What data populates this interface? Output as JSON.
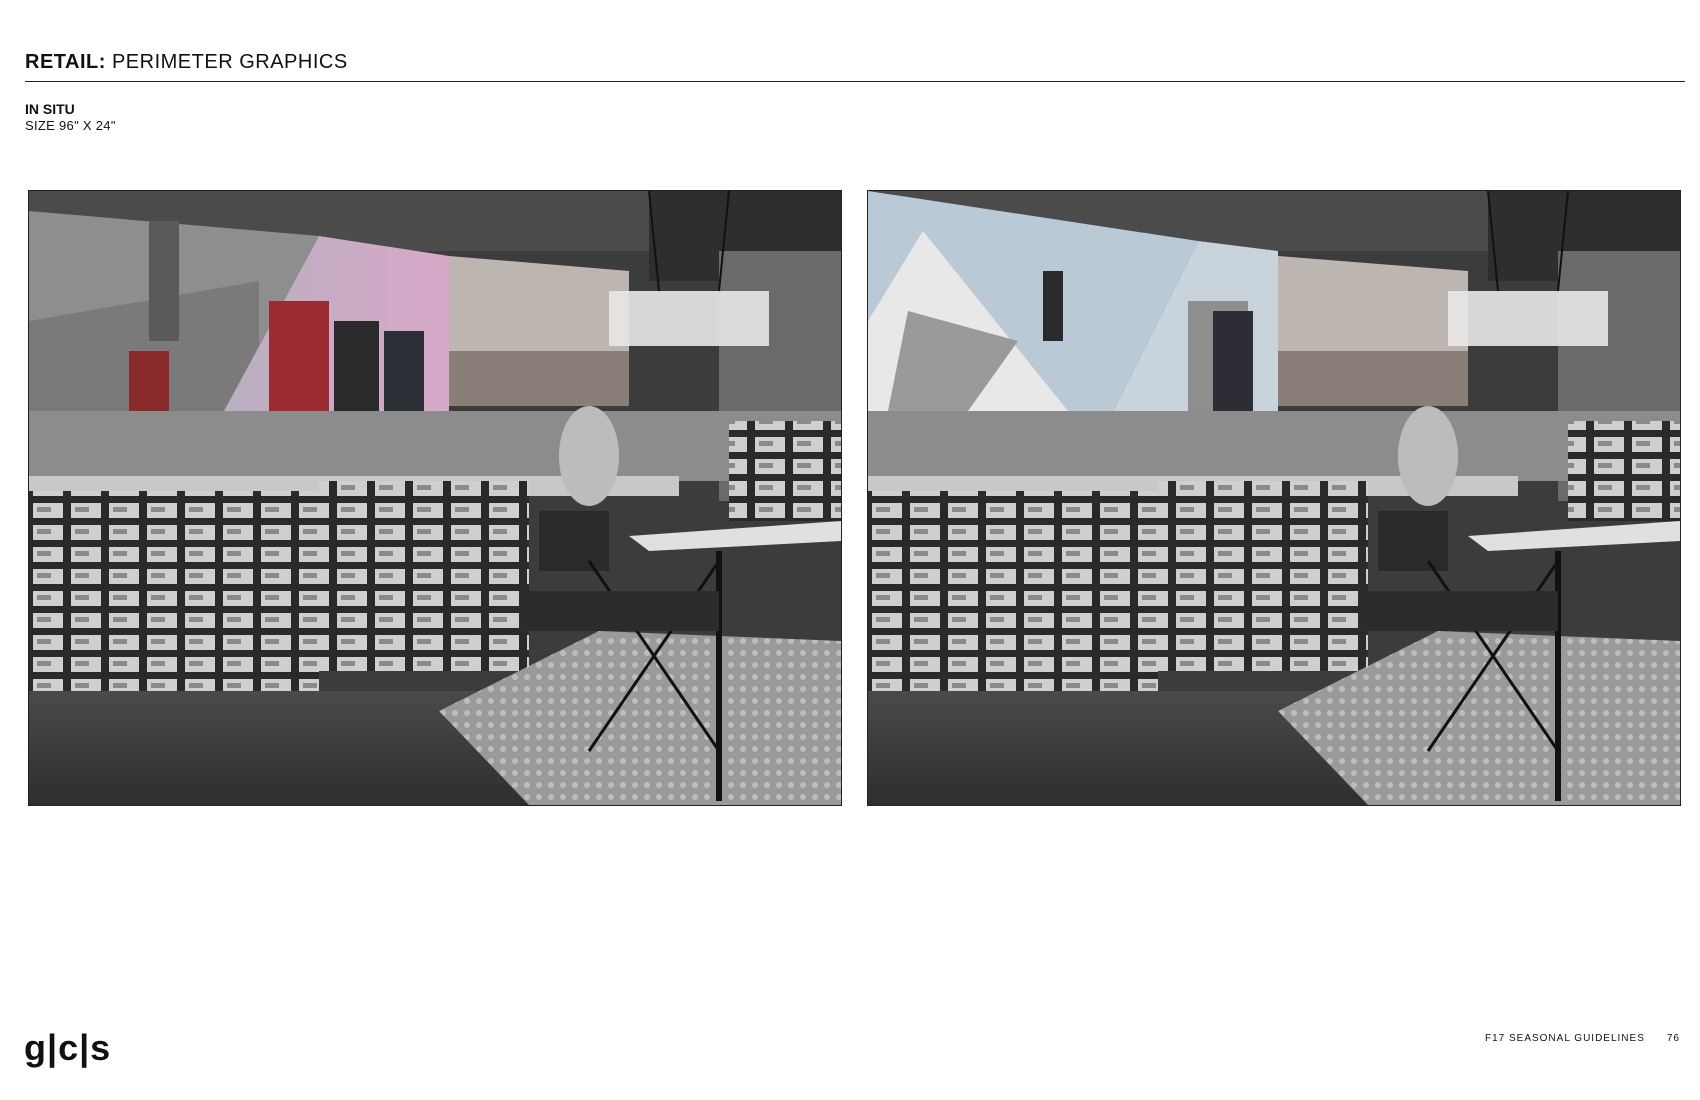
{
  "header": {
    "title_bold": "RETAIL:",
    "title_light": " PERIMETER GRAPHICS"
  },
  "subheader": {
    "label": "IN SITU",
    "size": "SIZE 96\" X 24\""
  },
  "images": [
    {
      "name": "in-situ-rendering-1",
      "description_icon": "store-interior-photo"
    },
    {
      "name": "in-situ-rendering-2",
      "description_icon": "store-interior-photo"
    }
  ],
  "footer": {
    "logo": "g|c|s",
    "guide": "F17 SEASONAL GUIDELINES",
    "page": "76"
  }
}
